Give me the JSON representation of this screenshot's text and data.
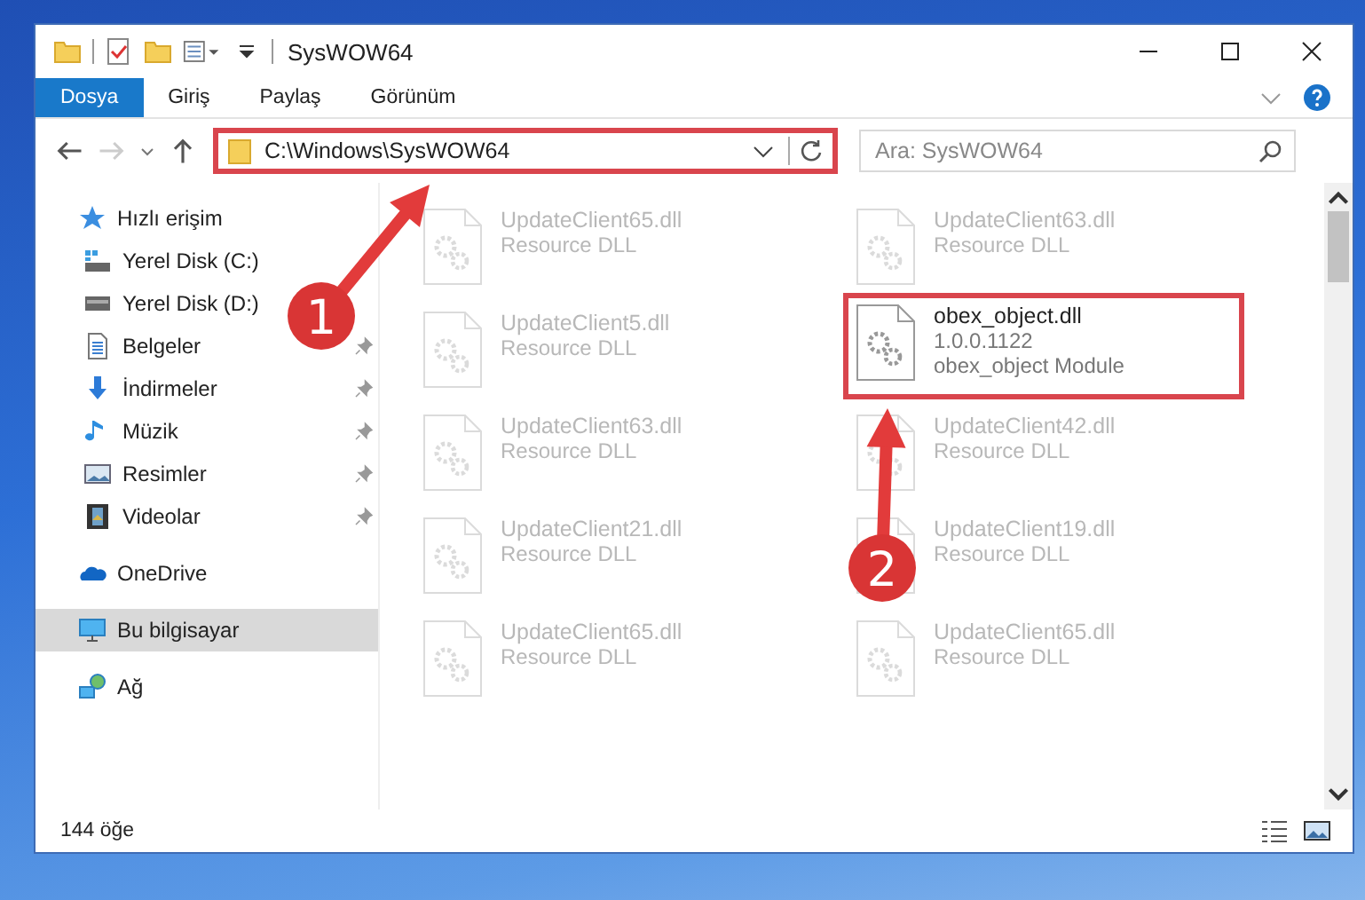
{
  "window": {
    "title": "SysWOW64"
  },
  "ribbon_tabs": [
    {
      "label": "Dosya",
      "selected": true
    },
    {
      "label": "Giriş",
      "selected": false
    },
    {
      "label": "Paylaş",
      "selected": false
    },
    {
      "label": "Görünüm",
      "selected": false
    }
  ],
  "address_bar": {
    "path": "C:\\Windows\\SysWOW64",
    "highlighted": true
  },
  "search": {
    "placeholder": "Ara: SysWOW64"
  },
  "sidebar": {
    "items": [
      {
        "label": "Hızlı erişim",
        "selected": false,
        "children": [
          {
            "label": "Yerel Disk (C:)",
            "pinned": false,
            "selected": false
          },
          {
            "label": "Yerel Disk (D:)",
            "pinned": false,
            "selected": false
          },
          {
            "label": "Belgeler",
            "pinned": true,
            "selected": false
          },
          {
            "label": "İndirmeler",
            "pinned": true,
            "selected": false
          },
          {
            "label": "Müzik",
            "pinned": true,
            "selected": false
          },
          {
            "label": "Resimler",
            "pinned": true,
            "selected": false
          },
          {
            "label": "Videolar",
            "pinned": true,
            "selected": false
          }
        ]
      },
      {
        "label": "OneDrive",
        "selected": false
      },
      {
        "label": "Bu bilgisayar",
        "selected": true
      },
      {
        "label": "Ağ",
        "selected": false
      }
    ]
  },
  "files": [
    {
      "name": "UpdateClient65.dll",
      "lines": [
        "Resource DLL"
      ],
      "faded": true,
      "highlighted": false
    },
    {
      "name": "UpdateClient63.dll",
      "lines": [
        "Resource DLL"
      ],
      "faded": true,
      "highlighted": false
    },
    {
      "name": "UpdateClient5.dll",
      "lines": [
        "Resource DLL"
      ],
      "faded": true,
      "highlighted": false
    },
    {
      "name": "obex_object.dll",
      "lines": [
        "1.0.0.1122",
        "obex_object Module"
      ],
      "faded": false,
      "highlighted": true
    },
    {
      "name": "UpdateClient63.dll",
      "lines": [
        "Resource DLL"
      ],
      "faded": true,
      "highlighted": false
    },
    {
      "name": "UpdateClient42.dll",
      "lines": [
        "Resource DLL"
      ],
      "faded": true,
      "highlighted": false
    },
    {
      "name": "UpdateClient21.dll",
      "lines": [
        "Resource DLL"
      ],
      "faded": true,
      "highlighted": false
    },
    {
      "name": "UpdateClient19.dll",
      "lines": [
        "Resource DLL"
      ],
      "faded": true,
      "highlighted": false
    },
    {
      "name": "UpdateClient65.dll",
      "lines": [
        "Resource DLL"
      ],
      "faded": true,
      "highlighted": false
    },
    {
      "name": "UpdateClient65.dll",
      "lines": [
        "Resource DLL"
      ],
      "faded": true,
      "highlighted": false
    }
  ],
  "status_bar": {
    "count": "144 öğe"
  },
  "annotations": [
    {
      "label": "1"
    },
    {
      "label": "2"
    }
  ]
}
